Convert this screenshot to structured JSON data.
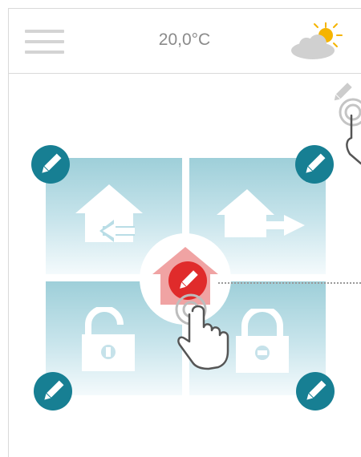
{
  "header": {
    "temperature": "20,0°C",
    "menu_icon": "hamburger-menu-icon",
    "weather_icon": "partly-sunny-icon"
  },
  "tiles": [
    {
      "name": "arrive-home",
      "icon": "house-arrow-in-icon"
    },
    {
      "name": "leave-home",
      "icon": "house-arrow-out-icon"
    },
    {
      "name": "unlock",
      "icon": "padlock-open-icon"
    },
    {
      "name": "lock",
      "icon": "padlock-closed-icon"
    }
  ],
  "center": {
    "icon": "house-edit-icon"
  },
  "colors": {
    "edit_button": "#177f93",
    "accent_red": "#e02b2b",
    "tile_top": "#9ecfd9",
    "text_gray": "#8a8a8a"
  },
  "hints": [
    "tap-gesture-icon",
    "tap-gesture-icon"
  ]
}
